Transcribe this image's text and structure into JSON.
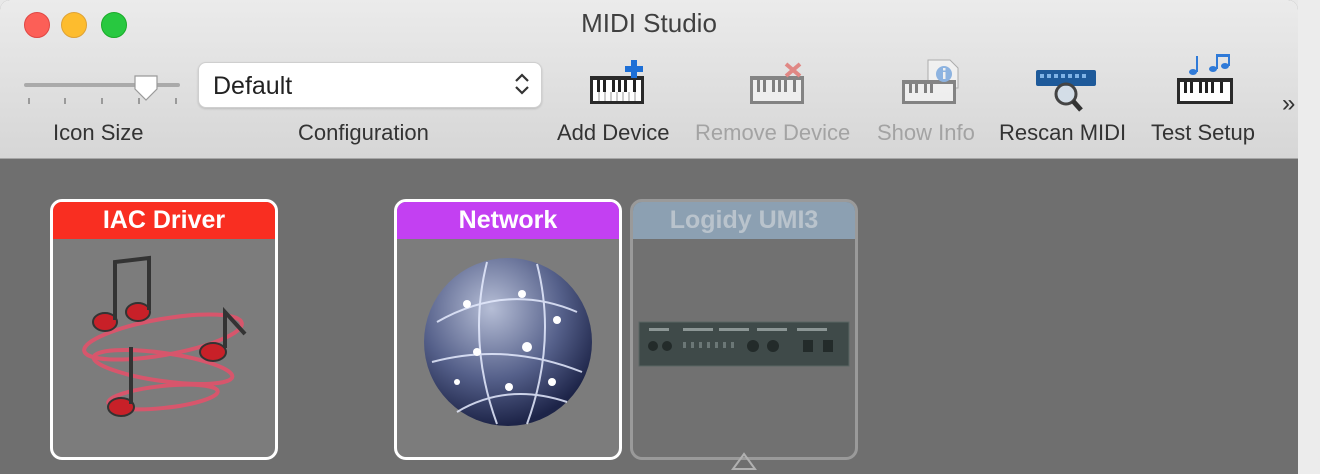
{
  "window": {
    "title": "MIDI Studio"
  },
  "toolbar": {
    "icon_size_label": "Icon Size",
    "configuration_label": "Configuration",
    "configuration_value": "Default",
    "add_device_label": "Add Device",
    "remove_device_label": "Remove Device",
    "show_info_label": "Show Info",
    "rescan_midi_label": "Rescan MIDI",
    "test_setup_label": "Test Setup",
    "overflow": "»"
  },
  "devices": [
    {
      "name": "IAC Driver",
      "color": "#f92e21",
      "icon": "music-notes-icon"
    },
    {
      "name": "Network",
      "color": "#c340f2",
      "icon": "network-globe-icon"
    },
    {
      "name": "Logidy UMI3",
      "color": "#8ca0b2",
      "icon": "midi-interface-icon",
      "state": "offline"
    }
  ],
  "colors": {
    "canvas": "#6f6f6f",
    "toolbar": "#e3e3e3"
  }
}
